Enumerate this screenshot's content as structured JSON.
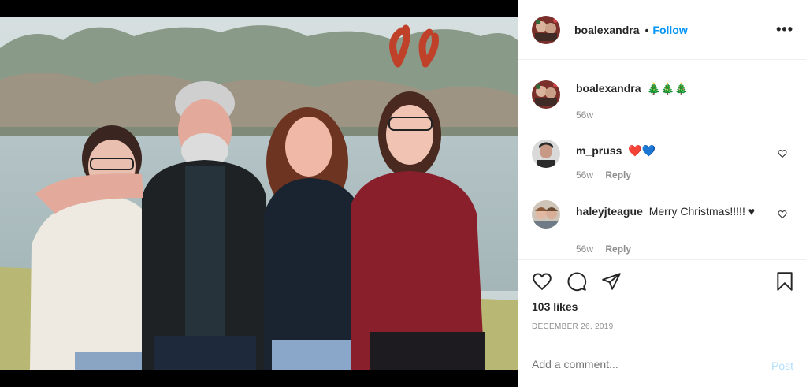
{
  "post": {
    "image_alt": "Family photo by a lake",
    "author": "boalexandra",
    "follow_label": "Follow",
    "separator": "•",
    "more_label": "•••"
  },
  "caption": {
    "username": "boalexandra",
    "text": "🎄🎄🎄",
    "time": "56w"
  },
  "comments": [
    {
      "username": "m_pruss",
      "text": "❤️💙",
      "time": "56w",
      "reply_label": "Reply"
    },
    {
      "username": "haleyjteague",
      "text": "Merry Christmas!!!!! ♥",
      "time": "56w",
      "reply_label": "Reply"
    }
  ],
  "actions": {
    "likes": "103 likes",
    "date": "DECEMBER 26, 2019"
  },
  "add_comment": {
    "placeholder": "Add a comment...",
    "post_label": "Post"
  },
  "colors": {
    "link": "#0095f6",
    "post_disabled": "#b2dffc",
    "muted": "#8e8e8e",
    "text": "#262626"
  },
  "icons": [
    "heart-icon",
    "comment-icon",
    "share-icon",
    "bookmark-icon",
    "more-icon"
  ]
}
